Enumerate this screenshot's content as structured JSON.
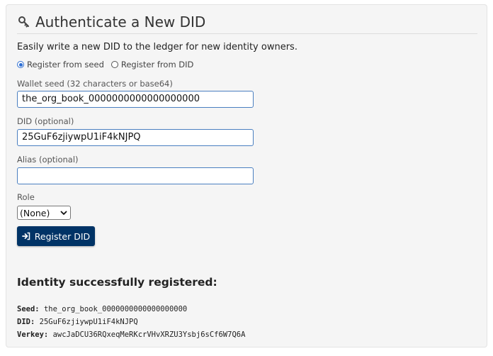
{
  "header": {
    "title": "Authenticate a New DID",
    "icon": "key-icon"
  },
  "intro": "Easily write a new DID to the ledger for new identity owners.",
  "mode": {
    "options": [
      "Register from seed",
      "Register from DID"
    ],
    "selected": "Register from seed"
  },
  "fields": {
    "seed": {
      "label": "Wallet seed (32 characters or base64)",
      "value": "the_org_book_0000000000000000000"
    },
    "did": {
      "label": "DID (optional)",
      "value": "25GuF6zjiywpU1iF4kNJPQ"
    },
    "alias": {
      "label": "Alias (optional)",
      "value": ""
    },
    "role": {
      "label": "Role",
      "selected": "(None)"
    }
  },
  "submit": {
    "label": "Register DID",
    "icon": "sign-in-icon"
  },
  "result": {
    "heading": "Identity successfully registered:",
    "seed_key": "Seed:",
    "seed_value": "the_org_book_0000000000000000000",
    "did_key": "DID:",
    "did_value": "25GuF6zjiywpU1iF4kNJPQ",
    "verkey_key": "Verkey:",
    "verkey_value": "awcJaDCU36RQxeqMeRKcrVHvXRZU3Ysbj6sCf6W7Q6A"
  },
  "colors": {
    "button_bg": "#003366",
    "input_border": "#4a7fc0",
    "radio_accent": "#2f6fd3"
  }
}
